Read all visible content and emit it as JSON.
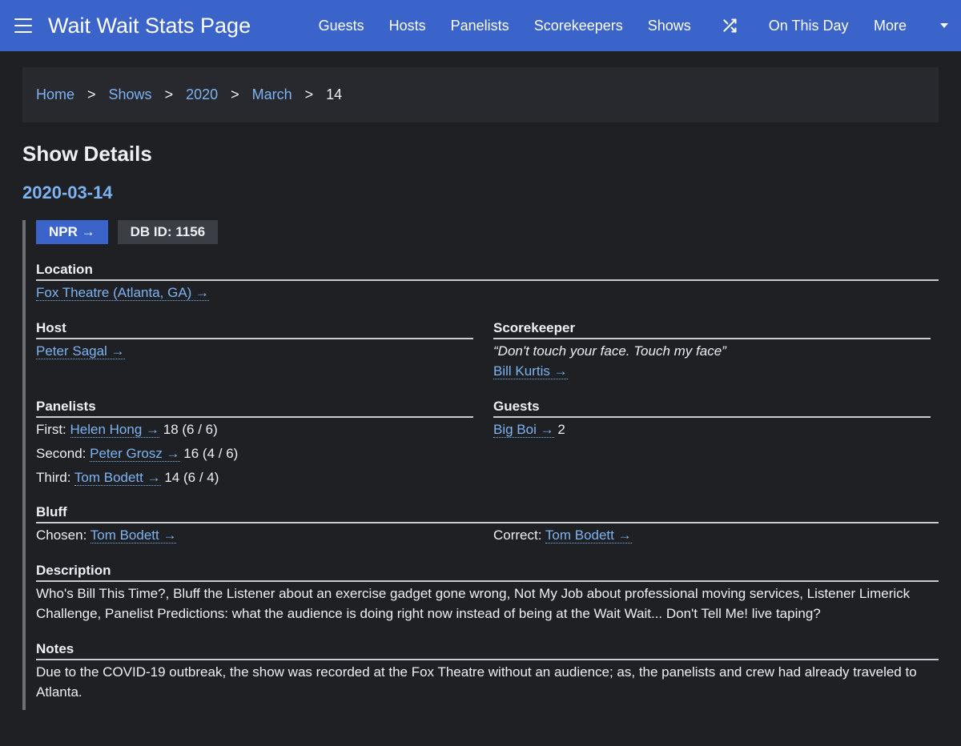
{
  "nav": {
    "brand": "Wait Wait Stats Page",
    "items": [
      "Guests",
      "Hosts",
      "Panelists",
      "Scorekeepers",
      "Shows"
    ],
    "on_this_day": "On This Day",
    "more": "More"
  },
  "breadcrumb": {
    "home": "Home",
    "shows": "Shows",
    "year": "2020",
    "month": "March",
    "day": "14",
    "sep": ">"
  },
  "page": {
    "title": "Show Details",
    "date": "2020-03-14"
  },
  "badges": {
    "npr": "NPR →",
    "db_id": "DB ID: 1156"
  },
  "location": {
    "heading": "Location",
    "value": "Fox Theatre (Atlanta, GA) →"
  },
  "host": {
    "heading": "Host",
    "name": "Peter Sagal →"
  },
  "scorekeeper": {
    "heading": "Scorekeeper",
    "quote": "“Don't touch your face. Touch my face”",
    "name": "Bill Kurtis →"
  },
  "panelists": {
    "heading": "Panelists",
    "rows": [
      {
        "label": "First:",
        "name": "Helen Hong →",
        "score": "18 (6 / 6)"
      },
      {
        "label": "Second:",
        "name": "Peter Grosz →",
        "score": "16 (4 / 6)"
      },
      {
        "label": "Third:",
        "name": "Tom Bodett →",
        "score": "14 (6 / 4)"
      }
    ]
  },
  "guests": {
    "heading": "Guests",
    "name": "Big Boi →",
    "score": "2"
  },
  "bluff": {
    "heading": "Bluff",
    "chosen_label": "Chosen:",
    "chosen": "Tom Bodett →",
    "correct_label": "Correct:",
    "correct": "Tom Bodett →"
  },
  "description": {
    "heading": "Description",
    "text": "Who's Bill This Time?, Bluff the Listener about an exercise gadget gone wrong, Not My Job about professional moving services, Listener Limerick Challenge, Panelist Predictions: what the audience is doing right now instead of being at the Wait Wait... Don't Tell Me! live taping?"
  },
  "notes": {
    "heading": "Notes",
    "text": "Due to the COVID-19 outbreak, the show was recorded at the Fox Theatre without an audience; as, the panelists and crew had already traveled to Atlanta."
  },
  "colors": {
    "topbar": "#3a64c9",
    "background": "#1e2024",
    "link": "#7db3f2"
  },
  "icons": [
    "menu-icon",
    "shuffle-icon",
    "caret-down-icon"
  ]
}
